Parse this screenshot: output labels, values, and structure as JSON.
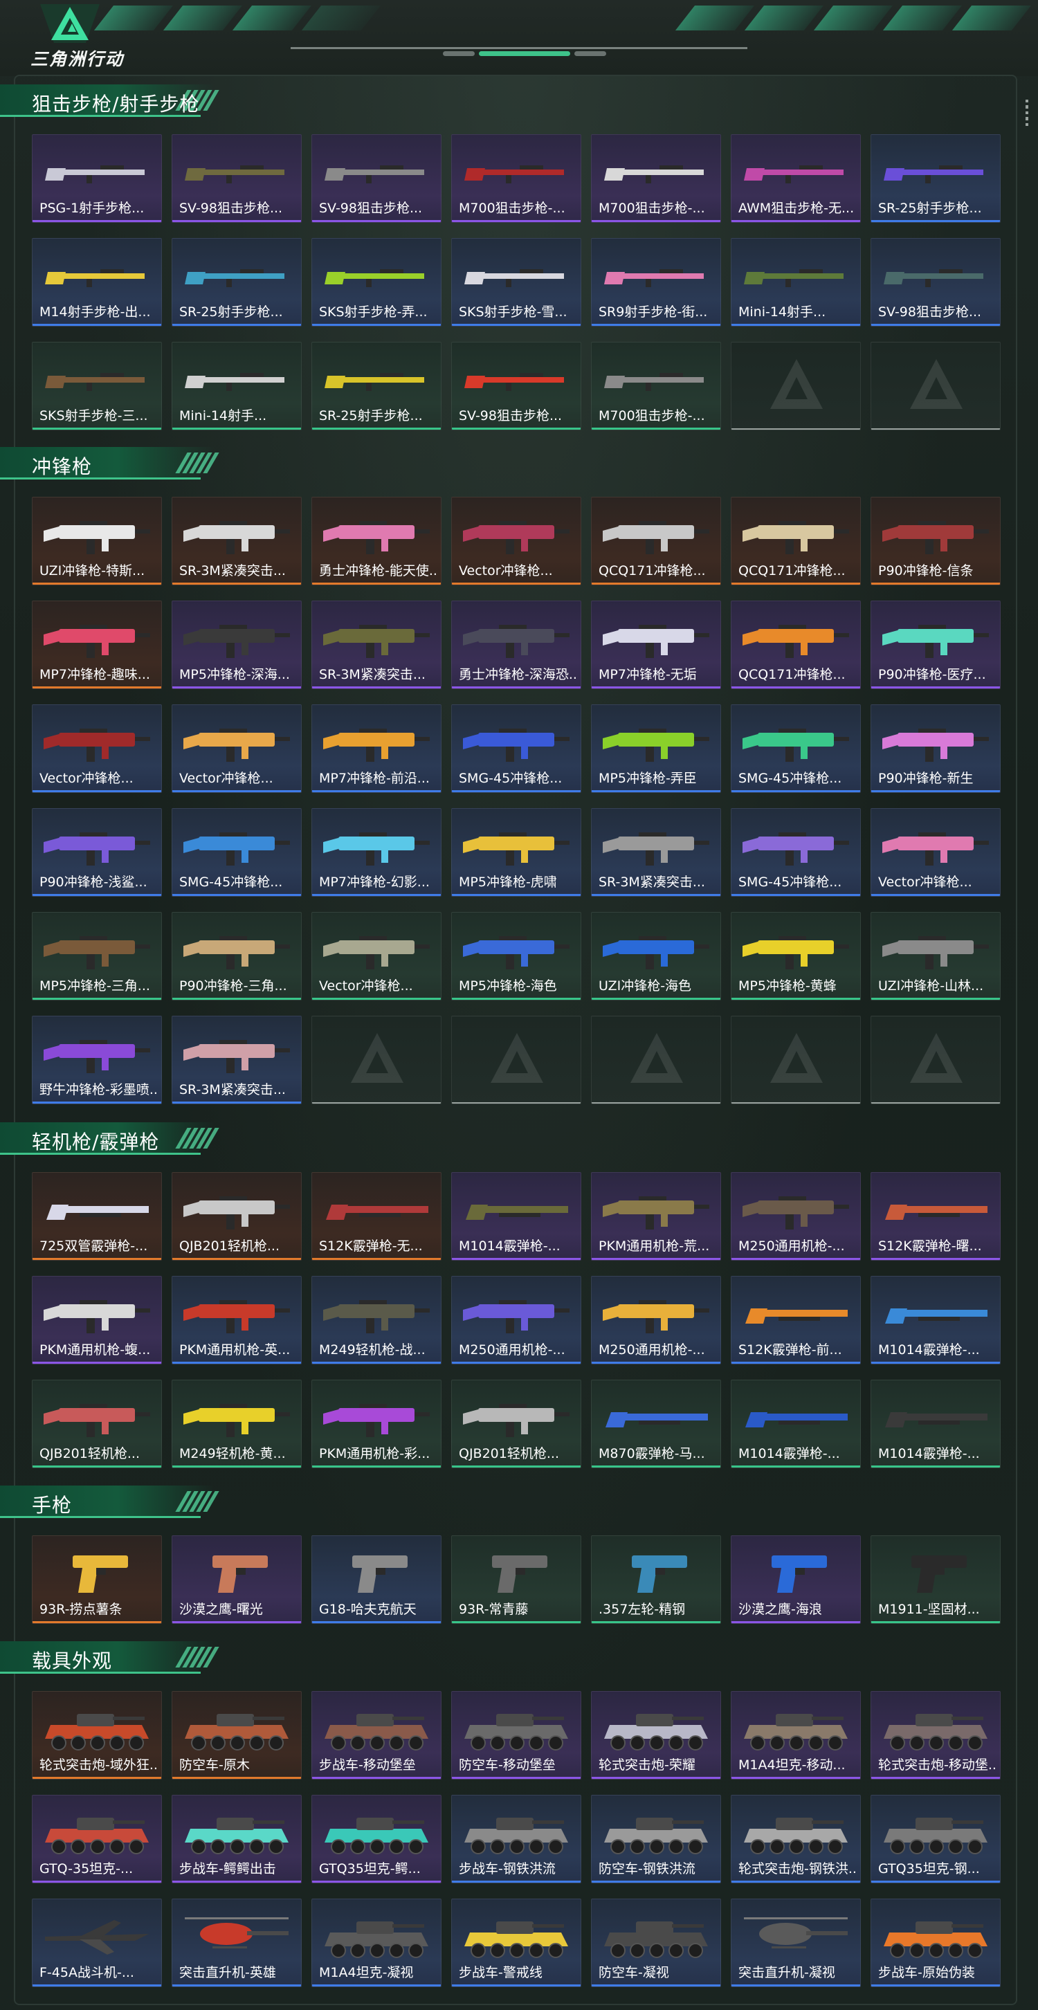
{
  "app": {
    "logo_text": "三角洲行动",
    "brand_color": "#3ec38a"
  },
  "rarity_colors": {
    "purple": "#8b56e6",
    "blue": "#3f7ce8",
    "green": "#38c58a",
    "orange": "#e27a2c",
    "empty": "#9aa39f"
  },
  "sections": [
    {
      "title": "狙击步枪/射手步枪",
      "items": [
        {
          "name": "PSG-1射手步枪...",
          "rarity": "purple",
          "icon": "rifle-icon",
          "accent": "#c9c9d6"
        },
        {
          "name": "SV-98狙击步枪...",
          "rarity": "purple",
          "icon": "rifle-icon",
          "accent": "#6f6a3f"
        },
        {
          "name": "SV-98狙击步枪...",
          "rarity": "purple",
          "icon": "rifle-icon",
          "accent": "#8a8a8a"
        },
        {
          "name": "M700狙击步枪-...",
          "rarity": "purple",
          "icon": "rifle-icon",
          "accent": "#b02a2a"
        },
        {
          "name": "M700狙击步枪-...",
          "rarity": "purple",
          "icon": "rifle-icon",
          "accent": "#d8d8d8"
        },
        {
          "name": "AWM狙击步枪-无...",
          "rarity": "purple",
          "icon": "rifle-icon",
          "accent": "#c04aa8"
        },
        {
          "name": "SR-25射手步枪...",
          "rarity": "blue",
          "icon": "rifle-icon",
          "accent": "#6a4fd8"
        },
        {
          "name": "M14射手步枪-出...",
          "rarity": "blue",
          "icon": "rifle-icon",
          "accent": "#e6c93a"
        },
        {
          "name": "SR-25射手步枪...",
          "rarity": "blue",
          "icon": "rifle-icon",
          "accent": "#3fa0c4"
        },
        {
          "name": "SKS射手步枪-弄...",
          "rarity": "blue",
          "icon": "rifle-icon",
          "accent": "#9ad02a"
        },
        {
          "name": "SKS射手步枪-雪...",
          "rarity": "blue",
          "icon": "rifle-icon",
          "accent": "#d8d8e0"
        },
        {
          "name": "SR9射手步枪-街...",
          "rarity": "blue",
          "icon": "rifle-icon",
          "accent": "#e07ab0"
        },
        {
          "name": "Mini-14射手...",
          "rarity": "blue",
          "icon": "rifle-icon",
          "accent": "#5e7a3a"
        },
        {
          "name": "SV-98狙击步枪...",
          "rarity": "blue",
          "icon": "rifle-icon",
          "accent": "#4a6a6a"
        },
        {
          "name": "SKS射手步枪-三...",
          "rarity": "green",
          "icon": "rifle-icon",
          "accent": "#7a5a3a"
        },
        {
          "name": "Mini-14射手...",
          "rarity": "green",
          "icon": "rifle-icon",
          "accent": "#d0d0d0"
        },
        {
          "name": "SR-25射手步枪...",
          "rarity": "green",
          "icon": "rifle-icon",
          "accent": "#d8c42a"
        },
        {
          "name": "SV-98狙击步枪...",
          "rarity": "green",
          "icon": "rifle-icon",
          "accent": "#d83a2a"
        },
        {
          "name": "M700狙击步枪-...",
          "rarity": "green",
          "icon": "rifle-icon",
          "accent": "#8a8a8a"
        },
        {
          "name": "",
          "rarity": "empty",
          "icon": "empty-slot-icon",
          "accent": ""
        },
        {
          "name": "",
          "rarity": "empty",
          "icon": "empty-slot-icon",
          "accent": ""
        }
      ]
    },
    {
      "title": "冲锋枪",
      "items": [
        {
          "name": "UZI冲锋枪-特斯...",
          "rarity": "orange",
          "icon": "smg-icon",
          "accent": "#e8e8e8"
        },
        {
          "name": "SR-3M紧凑突击...",
          "rarity": "orange",
          "icon": "smg-icon",
          "accent": "#d8d8d8"
        },
        {
          "name": "勇士冲锋枪-能天使...",
          "rarity": "orange",
          "icon": "smg-icon",
          "accent": "#e07ab0"
        },
        {
          "name": "Vector冲锋枪...",
          "rarity": "orange",
          "icon": "smg-icon",
          "accent": "#b03a5a"
        },
        {
          "name": "QCQ171冲锋枪...",
          "rarity": "orange",
          "icon": "smg-icon",
          "accent": "#c8c8c8"
        },
        {
          "name": "QCQ171冲锋枪...",
          "rarity": "orange",
          "icon": "smg-icon",
          "accent": "#d8c8a0"
        },
        {
          "name": "P90冲锋枪-信条",
          "rarity": "orange",
          "icon": "smg-icon",
          "accent": "#a03a3a"
        },
        {
          "name": "MP7冲锋枪-趣味...",
          "rarity": "orange",
          "icon": "smg-icon",
          "accent": "#e04a6a"
        },
        {
          "name": "MP5冲锋枪-深海...",
          "rarity": "purple",
          "icon": "smg-icon",
          "accent": "#3a3a3a"
        },
        {
          "name": "SR-3M紧凑突击...",
          "rarity": "purple",
          "icon": "smg-icon",
          "accent": "#6a6a3a"
        },
        {
          "name": "勇士冲锋枪-深海恐...",
          "rarity": "purple",
          "icon": "smg-icon",
          "accent": "#4a4a5a"
        },
        {
          "name": "MP7冲锋枪-无垢",
          "rarity": "purple",
          "icon": "smg-icon",
          "accent": "#d8d8e8"
        },
        {
          "name": "QCQ171冲锋枪...",
          "rarity": "purple",
          "icon": "smg-icon",
          "accent": "#e88a2a"
        },
        {
          "name": "P90冲锋枪-医疗...",
          "rarity": "purple",
          "icon": "smg-icon",
          "accent": "#5ad8c0"
        },
        {
          "name": "Vector冲锋枪...",
          "rarity": "blue",
          "icon": "smg-icon",
          "accent": "#a02a2a"
        },
        {
          "name": "Vector冲锋枪...",
          "rarity": "blue",
          "icon": "smg-icon",
          "accent": "#e8a84a"
        },
        {
          "name": "MP7冲锋枪-前沿...",
          "rarity": "blue",
          "icon": "smg-icon",
          "accent": "#e8a030"
        },
        {
          "name": "SMG-45冲锋枪...",
          "rarity": "blue",
          "icon": "smg-icon",
          "accent": "#3a5ad8"
        },
        {
          "name": "MP5冲锋枪-弄臣",
          "rarity": "blue",
          "icon": "smg-icon",
          "accent": "#8ad02a"
        },
        {
          "name": "SMG-45冲锋枪...",
          "rarity": "blue",
          "icon": "smg-icon",
          "accent": "#3ac88a"
        },
        {
          "name": "P90冲锋枪-新生",
          "rarity": "blue",
          "icon": "smg-icon",
          "accent": "#d87ad8"
        },
        {
          "name": "P90冲锋枪-浅鲨...",
          "rarity": "blue",
          "icon": "smg-icon",
          "accent": "#7a5ad8"
        },
        {
          "name": "SMG-45冲锋枪...",
          "rarity": "blue",
          "icon": "smg-icon",
          "accent": "#3a8ad8"
        },
        {
          "name": "MP7冲锋枪-幻影...",
          "rarity": "blue",
          "icon": "smg-icon",
          "accent": "#5ac8e8"
        },
        {
          "name": "MP5冲锋枪-虎啸",
          "rarity": "blue",
          "icon": "smg-icon",
          "accent": "#e8c03a"
        },
        {
          "name": "SR-3M紧凑突击...",
          "rarity": "blue",
          "icon": "smg-icon",
          "accent": "#9a9a9a"
        },
        {
          "name": "SMG-45冲锋枪...",
          "rarity": "blue",
          "icon": "smg-icon",
          "accent": "#8a6ad8"
        },
        {
          "name": "Vector冲锋枪...",
          "rarity": "blue",
          "icon": "smg-icon",
          "accent": "#e07ab0"
        },
        {
          "name": "MP5冲锋枪-三角...",
          "rarity": "green",
          "icon": "smg-icon",
          "accent": "#7a5a3a"
        },
        {
          "name": "P90冲锋枪-三角...",
          "rarity": "green",
          "icon": "smg-icon",
          "accent": "#c8a878"
        },
        {
          "name": "Vector冲锋枪...",
          "rarity": "green",
          "icon": "smg-icon",
          "accent": "#a8a890"
        },
        {
          "name": "MP5冲锋枪-海色",
          "rarity": "green",
          "icon": "smg-icon",
          "accent": "#3a6ad8"
        },
        {
          "name": "UZI冲锋枪-海色",
          "rarity": "green",
          "icon": "smg-icon",
          "accent": "#2a6ad8"
        },
        {
          "name": "MP5冲锋枪-黄蜂",
          "rarity": "green",
          "icon": "smg-icon",
          "accent": "#e8d02a"
        },
        {
          "name": "UZI冲锋枪-山林...",
          "rarity": "green",
          "icon": "smg-icon",
          "accent": "#8a8a8a"
        },
        {
          "name": "野牛冲锋枪-彩墨喷...",
          "rarity": "blue",
          "icon": "smg-icon",
          "accent": "#8a4ad8"
        },
        {
          "name": "SR-3M紧凑突击...",
          "rarity": "blue",
          "icon": "smg-icon",
          "accent": "#d0a0a8"
        },
        {
          "name": "",
          "rarity": "empty",
          "icon": "empty-slot-icon",
          "accent": ""
        },
        {
          "name": "",
          "rarity": "empty",
          "icon": "empty-slot-icon",
          "accent": ""
        },
        {
          "name": "",
          "rarity": "empty",
          "icon": "empty-slot-icon",
          "accent": ""
        },
        {
          "name": "",
          "rarity": "empty",
          "icon": "empty-slot-icon",
          "accent": ""
        },
        {
          "name": "",
          "rarity": "empty",
          "icon": "empty-slot-icon",
          "accent": ""
        }
      ]
    },
    {
      "title": "轻机枪/霰弹枪",
      "items": [
        {
          "name": "725双管霰弹枪-...",
          "rarity": "orange",
          "icon": "shotgun-icon",
          "accent": "#d8d8e8"
        },
        {
          "name": "QJB201轻机枪...",
          "rarity": "orange",
          "icon": "lmg-icon",
          "accent": "#c8c8c8"
        },
        {
          "name": "S12K霰弹枪-无...",
          "rarity": "orange",
          "icon": "shotgun-icon",
          "accent": "#b03a3a"
        },
        {
          "name": "M1014霰弹枪-...",
          "rarity": "purple",
          "icon": "shotgun-icon",
          "accent": "#6a6a3a"
        },
        {
          "name": "PKM通用机枪-荒...",
          "rarity": "purple",
          "icon": "lmg-icon",
          "accent": "#8a7a4a"
        },
        {
          "name": "M250通用机枪-...",
          "rarity": "purple",
          "icon": "lmg-icon",
          "accent": "#6a5a4a"
        },
        {
          "name": "S12K霰弹枪-曙...",
          "rarity": "purple",
          "icon": "shotgun-icon",
          "accent": "#c85a3a"
        },
        {
          "name": "PKM通用机枪-蝮...",
          "rarity": "purple",
          "icon": "lmg-icon",
          "accent": "#d8d8d8"
        },
        {
          "name": "PKM通用机枪-英...",
          "rarity": "blue",
          "icon": "lmg-icon",
          "accent": "#c83a2a"
        },
        {
          "name": "M249轻机枪-战...",
          "rarity": "blue",
          "icon": "lmg-icon",
          "accent": "#5a5a4a"
        },
        {
          "name": "M250通用机枪-...",
          "rarity": "blue",
          "icon": "lmg-icon",
          "accent": "#6a5ad8"
        },
        {
          "name": "M250通用机枪-...",
          "rarity": "blue",
          "icon": "lmg-icon",
          "accent": "#e8b03a"
        },
        {
          "name": "S12K霰弹枪-前...",
          "rarity": "blue",
          "icon": "shotgun-icon",
          "accent": "#e88a2a"
        },
        {
          "name": "M1014霰弹枪-...",
          "rarity": "blue",
          "icon": "shotgun-icon",
          "accent": "#3a8ad8"
        },
        {
          "name": "QJB201轻机枪...",
          "rarity": "green",
          "icon": "lmg-icon",
          "accent": "#c85a5a"
        },
        {
          "name": "M249轻机枪-黄...",
          "rarity": "green",
          "icon": "lmg-icon",
          "accent": "#e8d02a"
        },
        {
          "name": "PKM通用机枪-彩...",
          "rarity": "green",
          "icon": "lmg-icon",
          "accent": "#a84ad8"
        },
        {
          "name": "QJB201轻机枪...",
          "rarity": "green",
          "icon": "lmg-icon",
          "accent": "#b8b8b8"
        },
        {
          "name": "M870霰弹枪-马...",
          "rarity": "green",
          "icon": "shotgun-icon",
          "accent": "#3a6ad8"
        },
        {
          "name": "M1014霰弹枪-...",
          "rarity": "green",
          "icon": "shotgun-icon",
          "accent": "#2a5ac8"
        },
        {
          "name": "M1014霰弹枪-...",
          "rarity": "green",
          "icon": "shotgun-icon",
          "accent": "#3a3a3a"
        }
      ]
    },
    {
      "title": "手枪",
      "items": [
        {
          "name": "93R-捞点薯条",
          "rarity": "orange",
          "icon": "pistol-icon",
          "accent": "#e8b83a"
        },
        {
          "name": "沙漠之鹰-曙光",
          "rarity": "purple",
          "icon": "pistol-icon",
          "accent": "#c87a5a"
        },
        {
          "name": "G18-哈夫克航天",
          "rarity": "blue",
          "icon": "pistol-icon",
          "accent": "#8a8a8a"
        },
        {
          "name": "93R-常青藤",
          "rarity": "green",
          "icon": "pistol-icon",
          "accent": "#6a6a6a"
        },
        {
          "name": ".357左轮-精钢",
          "rarity": "green",
          "icon": "revolver-icon",
          "accent": "#3a8ab8"
        },
        {
          "name": "沙漠之鹰-海浪",
          "rarity": "purple",
          "icon": "pistol-icon",
          "accent": "#2a6ad8"
        },
        {
          "name": "M1911-坚固材...",
          "rarity": "green",
          "icon": "pistol-icon",
          "accent": "#2a2a2a"
        }
      ]
    },
    {
      "title": "载具外观",
      "items": [
        {
          "name": "轮式突击炮-域外狂...",
          "rarity": "orange",
          "icon": "armored-car-icon",
          "accent": "#c84a2a"
        },
        {
          "name": "防空车-原木",
          "rarity": "orange",
          "icon": "aa-vehicle-icon",
          "accent": "#b05a3a"
        },
        {
          "name": "步战车-移动堡垒",
          "rarity": "purple",
          "icon": "ifv-icon",
          "accent": "#8a5a4a"
        },
        {
          "name": "防空车-移动堡垒",
          "rarity": "purple",
          "icon": "aa-vehicle-icon",
          "accent": "#6a6a6a"
        },
        {
          "name": "轮式突击炮-荣耀",
          "rarity": "purple",
          "icon": "armored-car-icon",
          "accent": "#b8b8c8"
        },
        {
          "name": "M1A4坦克-移动...",
          "rarity": "purple",
          "icon": "tank-icon",
          "accent": "#8a7a6a"
        },
        {
          "name": "轮式突击炮-移动堡...",
          "rarity": "purple",
          "icon": "armored-car-icon",
          "accent": "#7a6a6a"
        },
        {
          "name": "GTQ-35坦克-...",
          "rarity": "purple",
          "icon": "tank-icon",
          "accent": "#c84a3a"
        },
        {
          "name": "步战车-鳄鳄出击",
          "rarity": "purple",
          "icon": "ifv-icon",
          "accent": "#5ad8c8"
        },
        {
          "name": "GTQ35坦克-鳄...",
          "rarity": "purple",
          "icon": "tank-icon",
          "accent": "#3ac8b8"
        },
        {
          "name": "步战车-钢铁洪流",
          "rarity": "blue",
          "icon": "ifv-icon",
          "accent": "#8a8a8a"
        },
        {
          "name": "防空车-钢铁洪流",
          "rarity": "blue",
          "icon": "aa-vehicle-icon",
          "accent": "#9a9a9a"
        },
        {
          "name": "轮式突击炮-钢铁洪...",
          "rarity": "blue",
          "icon": "armored-car-icon",
          "accent": "#a8a8a8"
        },
        {
          "name": "GTQ35坦克-钢...",
          "rarity": "blue",
          "icon": "tank-icon",
          "accent": "#7a7a7a"
        },
        {
          "name": "F-45A战斗机-...",
          "rarity": "blue",
          "icon": "jet-icon",
          "accent": "#3a3a3a"
        },
        {
          "name": "突击直升机-英雄",
          "rarity": "blue",
          "icon": "helicopter-icon",
          "accent": "#c83a2a"
        },
        {
          "name": "M1A4坦克-凝视",
          "rarity": "blue",
          "icon": "tank-icon",
          "accent": "#5a5a5a"
        },
        {
          "name": "步战车-警戒线",
          "rarity": "blue",
          "icon": "ifv-icon",
          "accent": "#e8c83a"
        },
        {
          "name": "防空车-凝视",
          "rarity": "blue",
          "icon": "aa-vehicle-icon",
          "accent": "#4a4a4a"
        },
        {
          "name": "突击直升机-凝视",
          "rarity": "blue",
          "icon": "helicopter-icon",
          "accent": "#5a5a5a"
        },
        {
          "name": "步战车-原始伪装",
          "rarity": "blue",
          "icon": "ifv-icon",
          "accent": "#e8782a"
        }
      ]
    }
  ]
}
